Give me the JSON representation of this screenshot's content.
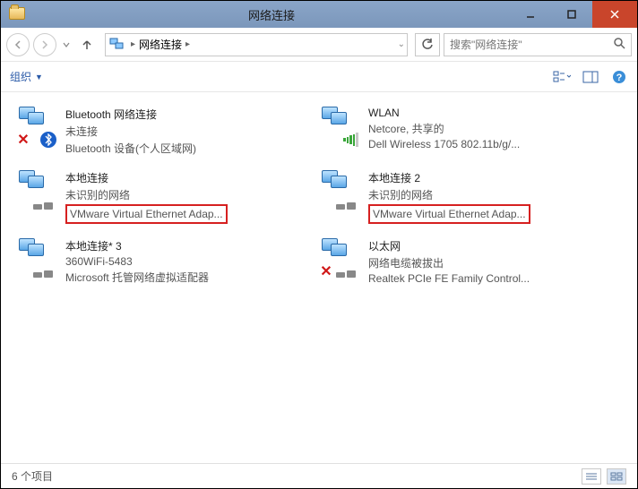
{
  "window": {
    "title": "网络连接"
  },
  "nav": {
    "breadcrumb": "网络连接",
    "search_placeholder": "搜索\"网络连接\""
  },
  "toolbar": {
    "organize": "组织"
  },
  "connections": [
    {
      "name": "Bluetooth 网络连接",
      "status": "未连接",
      "device": "Bluetooth 设备(个人区域网)",
      "overlay": "bluetooth_x",
      "highlight_device": false
    },
    {
      "name": "WLAN",
      "status": "Netcore, 共享的",
      "device": "Dell Wireless 1705 802.11b/g/...",
      "overlay": "wifi_bars",
      "highlight_device": false
    },
    {
      "name": "本地连接",
      "status": "未识别的网络",
      "device": "VMware Virtual Ethernet Adap...",
      "overlay": "plug",
      "highlight_device": true
    },
    {
      "name": "本地连接 2",
      "status": "未识别的网络",
      "device": "VMware Virtual Ethernet Adap...",
      "overlay": "plug",
      "highlight_device": true
    },
    {
      "name": "本地连接* 3",
      "status": "360WiFi-5483",
      "device": "Microsoft 托管网络虚拟适配器",
      "overlay": "plug",
      "highlight_device": false
    },
    {
      "name": "以太网",
      "status": "网络电缆被拔出",
      "device": "Realtek PCIe FE Family Control...",
      "overlay": "red_x_plug",
      "highlight_device": false
    }
  ],
  "status": {
    "item_count": "6 个项目"
  }
}
